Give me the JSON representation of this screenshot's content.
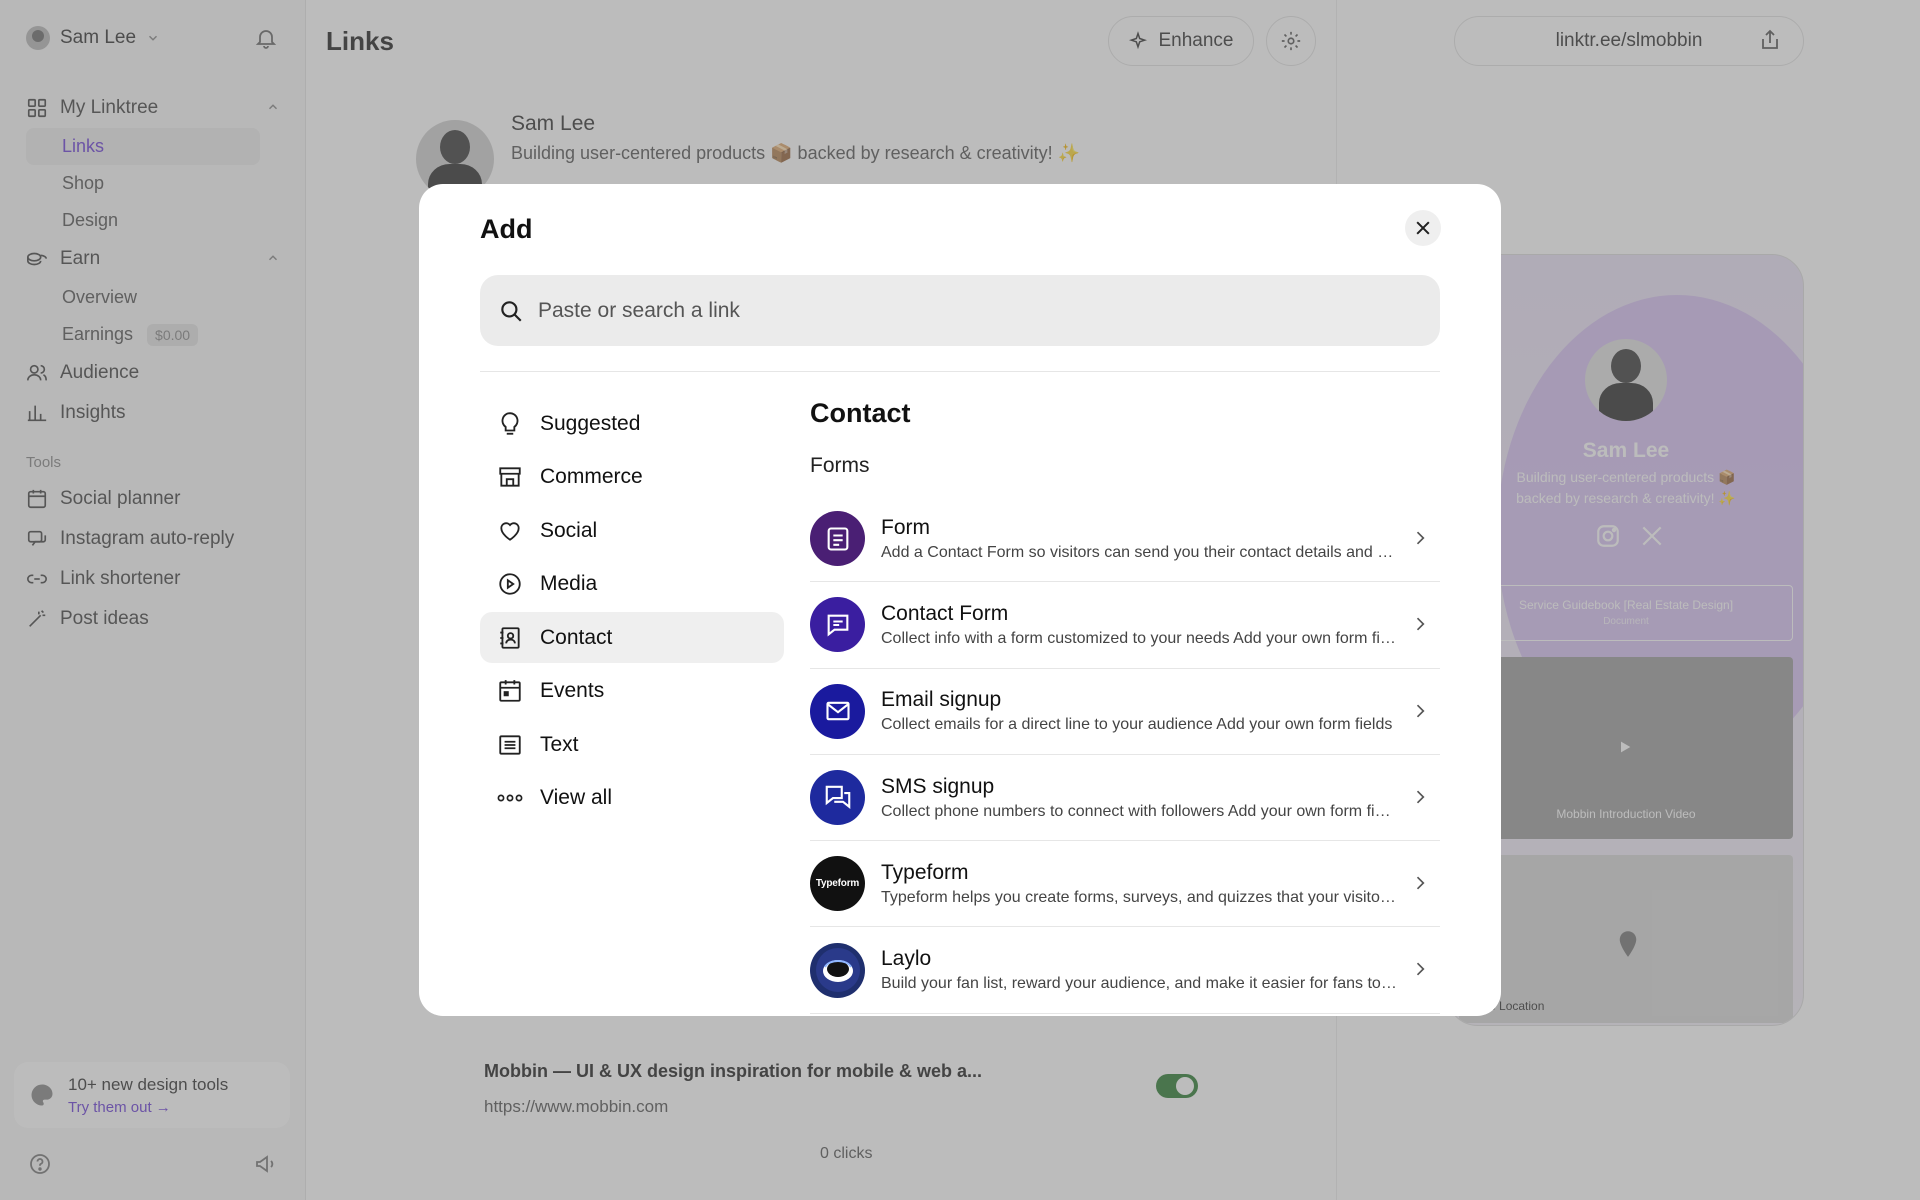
{
  "sidebar": {
    "user_name": "Sam Lee",
    "sections": {
      "my_linktree": "My Linktree",
      "links": "Links",
      "shop": "Shop",
      "design": "Design",
      "earn": "Earn",
      "overview": "Overview",
      "earnings": "Earnings",
      "earnings_badge": "$0.00",
      "audience": "Audience",
      "insights": "Insights",
      "tools_label": "Tools",
      "social_planner": "Social planner",
      "instagram_auto_reply": "Instagram auto-reply",
      "link_shortener": "Link shortener",
      "post_ideas": "Post ideas"
    },
    "promo": {
      "title": "10+ new design tools",
      "link": "Try them out →"
    }
  },
  "header": {
    "title": "Links",
    "enhance_label": "Enhance",
    "url": "linktr.ee/slmobbin"
  },
  "profile": {
    "name": "Sam Lee",
    "bio": "Building user-centered products 📦 backed by research & creativity! ✨"
  },
  "link_card": {
    "title": "Mobbin — UI & UX design inspiration for mobile & web a...",
    "url": "https://www.mobbin.com",
    "clicks": "0 clicks"
  },
  "preview": {
    "name": "Sam Lee",
    "bio": "Building user-centered products 📦 backed by research & creativity! ✨",
    "card_title": "Service Guidebook [Real Estate Design]",
    "card_subtitle": "Document",
    "video_title": "Mobbin Introduction Video",
    "map_label": "Store Location"
  },
  "modal": {
    "title": "Add",
    "search_placeholder": "Paste or search a link",
    "categories": [
      {
        "label": "Suggested",
        "icon": "lightbulb-icon"
      },
      {
        "label": "Commerce",
        "icon": "store-icon"
      },
      {
        "label": "Social",
        "icon": "heart-icon"
      },
      {
        "label": "Media",
        "icon": "play-circle-icon"
      },
      {
        "label": "Contact",
        "icon": "contact-book-icon"
      },
      {
        "label": "Events",
        "icon": "calendar-icon"
      },
      {
        "label": "Text",
        "icon": "text-lines-icon"
      },
      {
        "label": "View all",
        "icon": "more-dots-icon"
      }
    ],
    "active_category": "Contact",
    "section_title": "Contact",
    "subsection_title": "Forms",
    "items": [
      {
        "title": "Form",
        "desc": "Add a Contact Form so visitors can send you their contact details and more",
        "color": "#4a1f74"
      },
      {
        "title": "Contact Form",
        "desc": "Collect info with a form customized to your needs Add your own form fields",
        "color": "#3a1ea0"
      },
      {
        "title": "Email signup",
        "desc": "Collect emails for a direct line to your audience Add your own form fields",
        "color": "#1a1a9e"
      },
      {
        "title": "SMS signup",
        "desc": "Collect phone numbers to connect with followers Add your own form fields",
        "color": "#1e2a9e"
      },
      {
        "title": "Typeform",
        "desc": "Typeform helps you create forms, surveys, and quizzes that your visitors love",
        "color": "#111111",
        "logo_text": "Typeform"
      },
      {
        "title": "Laylo",
        "desc": "Build your fan list, reward your audience, and make it easier for fans to find you",
        "color": "#1f2f6e"
      }
    ]
  }
}
